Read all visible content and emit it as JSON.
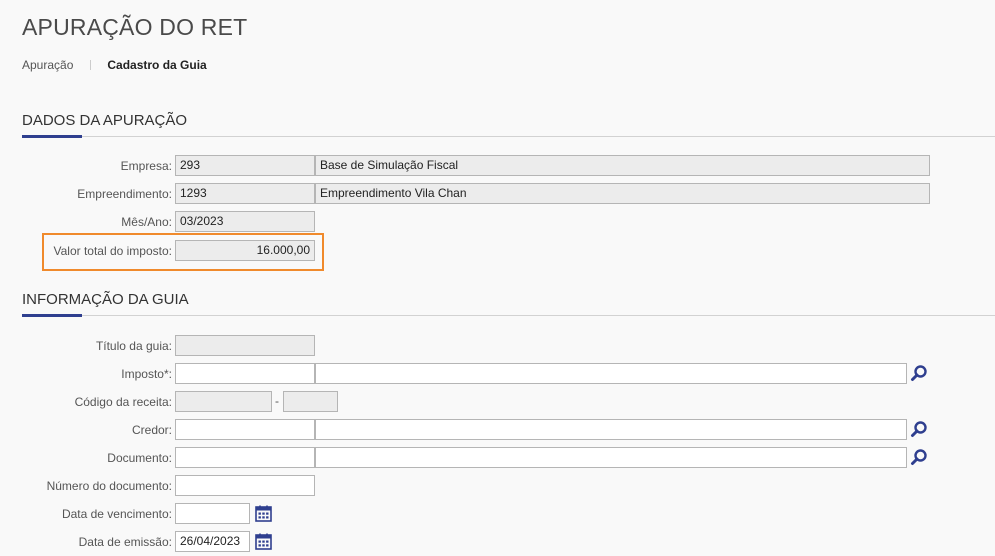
{
  "page": {
    "title": "APURAÇÃO DO RET"
  },
  "breadcrumb": {
    "items": [
      "Apuração",
      "Cadastro da Guia"
    ]
  },
  "sections": {
    "apuracao": {
      "title": "DADOS DA APURAÇÃO",
      "empresa": {
        "label": "Empresa:",
        "code": "293",
        "name": "Base de Simulação Fiscal"
      },
      "empreendimento": {
        "label": "Empreendimento:",
        "code": "1293",
        "name": "Empreendimento Vila Chan"
      },
      "mes_ano": {
        "label": "Mês/Ano:",
        "value": "03/2023"
      },
      "valor_total": {
        "label": "Valor total do imposto:",
        "value": "16.000,00"
      }
    },
    "guia": {
      "title": "INFORMAÇÃO DA GUIA",
      "titulo": {
        "label": "Título da guia:",
        "value": ""
      },
      "imposto": {
        "label": "Imposto*:",
        "code": "",
        "name": ""
      },
      "codigo_receita": {
        "label": "Código da receita:",
        "value": "",
        "suffix": "",
        "separator": "-"
      },
      "credor": {
        "label": "Credor:",
        "code": "",
        "name": ""
      },
      "documento": {
        "label": "Documento:",
        "code": "",
        "name": ""
      },
      "numero_documento": {
        "label": "Número do documento:",
        "value": ""
      },
      "data_vencimento": {
        "label": "Data de vencimento:",
        "value": ""
      },
      "data_emissao": {
        "label": "Data de emissão:",
        "value": "26/04/2023"
      }
    }
  },
  "icons": {
    "search": "search-icon",
    "calendar": "calendar-icon"
  },
  "colors": {
    "accent": "#2f3f8f",
    "highlight": "#f08a2c",
    "readonly_bg": "#ececec"
  }
}
